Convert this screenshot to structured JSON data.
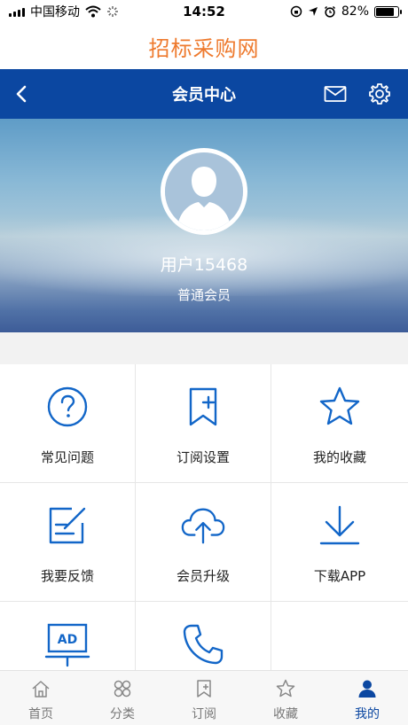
{
  "status_bar": {
    "carrier": "中国移动",
    "time": "14:52",
    "battery": "82%",
    "battery_level": 0.82
  },
  "brand": {
    "title": "招标采购网"
  },
  "navbar": {
    "title": "会员中心",
    "back_icon": "chevron-left-icon",
    "mail_icon": "mail-icon",
    "settings_icon": "gear-icon"
  },
  "profile": {
    "username": "用户15468",
    "level": "普通会员"
  },
  "colors": {
    "brand_orange": "#ee7a2e",
    "nav_blue": "#0b47a1",
    "icon_blue": "#1266c8"
  },
  "grid": {
    "items": [
      {
        "label": "常见问题",
        "icon": "question-icon"
      },
      {
        "label": "订阅设置",
        "icon": "bookmark-add-icon"
      },
      {
        "label": "我的收藏",
        "icon": "star-icon"
      },
      {
        "label": "我要反馈",
        "icon": "feedback-edit-icon"
      },
      {
        "label": "会员升级",
        "icon": "cloud-upload-icon"
      },
      {
        "label": "下载APP",
        "icon": "download-icon"
      },
      {
        "label": "",
        "icon": "ad-board-icon"
      },
      {
        "label": "",
        "icon": "phone-icon"
      }
    ]
  },
  "tabbar": {
    "items": [
      {
        "label": "首页",
        "icon": "home-icon"
      },
      {
        "label": "分类",
        "icon": "category-icon"
      },
      {
        "label": "订阅",
        "icon": "subscribe-icon"
      },
      {
        "label": "收藏",
        "icon": "star-outline-icon"
      },
      {
        "label": "我的",
        "icon": "user-icon",
        "active": true
      }
    ]
  }
}
